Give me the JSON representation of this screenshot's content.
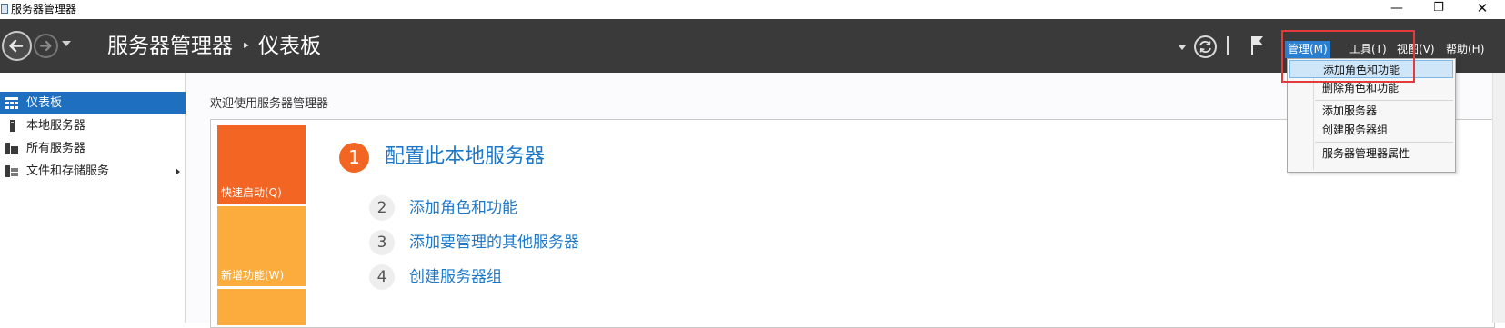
{
  "window": {
    "title": "服务器管理器",
    "minimize_glyph": "—",
    "maximize_glyph": "❐",
    "close_glyph": "✕"
  },
  "header": {
    "breadcrumb_root": "服务器管理器",
    "breadcrumb_separator": "▸",
    "breadcrumb_current": "仪表板"
  },
  "menubar": {
    "manage": "管理(M)",
    "tools": "工具(T)",
    "view": "视图(V)",
    "help": "帮助(H)"
  },
  "manage_menu": {
    "items": [
      "添加角色和功能",
      "删除角色和功能",
      "添加服务器",
      "创建服务器组",
      "服务器管理器属性"
    ],
    "selected_index": 0
  },
  "sidebar": {
    "items": [
      {
        "label": "仪表板",
        "icon": "dashboard-icon",
        "active": true
      },
      {
        "label": "本地服务器",
        "icon": "server-icon",
        "active": false
      },
      {
        "label": "所有服务器",
        "icon": "servers-icon",
        "active": false
      },
      {
        "label": "文件和存储服务",
        "icon": "file-storage-icon",
        "active": false,
        "has_submenu": true
      }
    ]
  },
  "main": {
    "welcome": "欢迎使用服务器管理器",
    "tiles": {
      "quick_start": "快速启动(Q)",
      "new_features": "新增功能(W)"
    },
    "steps": [
      {
        "number": "1",
        "label": "配置此本地服务器"
      },
      {
        "number": "2",
        "label": "添加角色和功能"
      },
      {
        "number": "3",
        "label": "添加要管理的其他服务器"
      },
      {
        "number": "4",
        "label": "创建服务器组"
      }
    ]
  },
  "colors": {
    "header_bg": "#3a3a3a",
    "accent_blue": "#1e6fbf",
    "tile_orange": "#f26522",
    "tile_amber": "#fbac3c",
    "link_blue": "#1e78c8",
    "highlight_red": "#e23b3b"
  }
}
